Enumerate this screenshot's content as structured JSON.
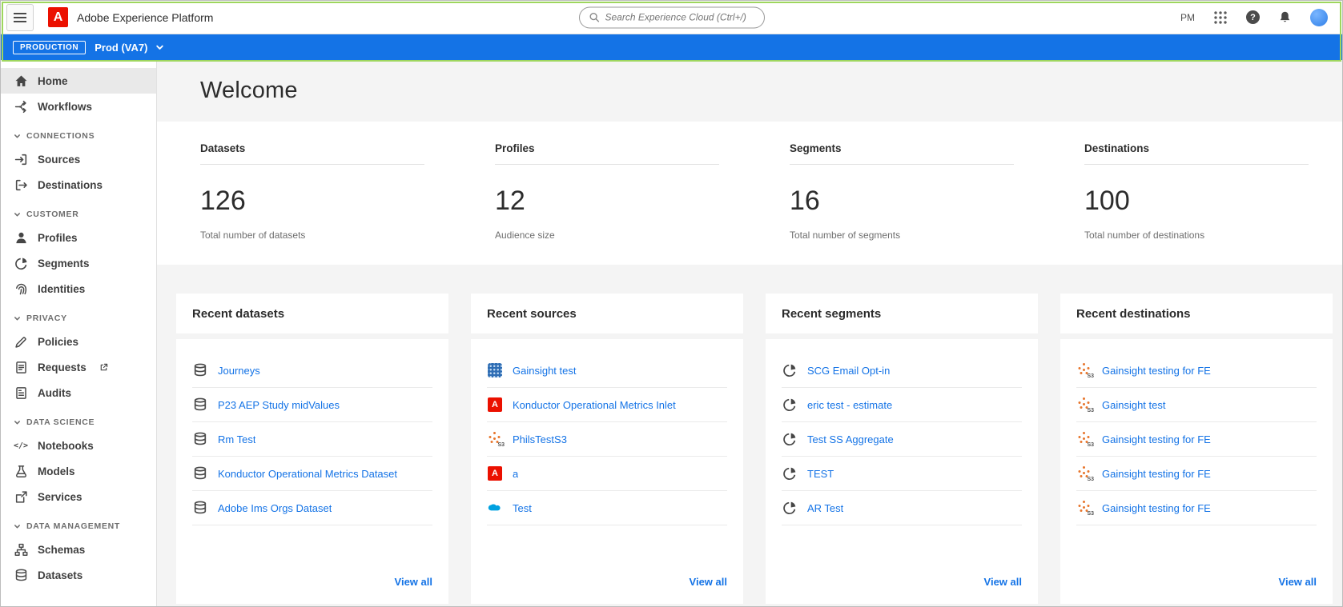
{
  "header": {
    "title": "Adobe Experience Platform",
    "search_placeholder": "Search Experience Cloud (Ctrl+/)",
    "time_label": "PM"
  },
  "sandbox_bar": {
    "env_label": "PRODUCTION",
    "sandbox_name": "Prod (VA7)"
  },
  "sidebar": {
    "top_items": [
      {
        "label": "Home",
        "icon": "home-icon",
        "active": true
      },
      {
        "label": "Workflows",
        "icon": "workflows-icon",
        "active": false
      }
    ],
    "sections": [
      {
        "title": "CONNECTIONS",
        "items": [
          {
            "label": "Sources",
            "icon": "sources-icon"
          },
          {
            "label": "Destinations",
            "icon": "destinations-icon"
          }
        ]
      },
      {
        "title": "CUSTOMER",
        "items": [
          {
            "label": "Profiles",
            "icon": "profiles-icon"
          },
          {
            "label": "Segments",
            "icon": "segments-icon"
          },
          {
            "label": "Identities",
            "icon": "identities-icon"
          }
        ]
      },
      {
        "title": "PRIVACY",
        "items": [
          {
            "label": "Policies",
            "icon": "policies-icon"
          },
          {
            "label": "Requests",
            "icon": "requests-icon",
            "external": true
          },
          {
            "label": "Audits",
            "icon": "audits-icon"
          }
        ]
      },
      {
        "title": "DATA SCIENCE",
        "items": [
          {
            "label": "Notebooks",
            "icon": "notebooks-icon"
          },
          {
            "label": "Models",
            "icon": "models-icon"
          },
          {
            "label": "Services",
            "icon": "services-icon"
          }
        ]
      },
      {
        "title": "DATA MANAGEMENT",
        "items": [
          {
            "label": "Schemas",
            "icon": "schemas-icon"
          },
          {
            "label": "Datasets",
            "icon": "datasets-icon"
          }
        ]
      }
    ]
  },
  "main": {
    "page_title": "Welcome",
    "stats": [
      {
        "label": "Datasets",
        "value": "126",
        "caption": "Total number of datasets"
      },
      {
        "label": "Profiles",
        "value": "12",
        "caption": "Audience size"
      },
      {
        "label": "Segments",
        "value": "16",
        "caption": "Total number of segments"
      },
      {
        "label": "Destinations",
        "value": "100",
        "caption": "Total number of destinations"
      }
    ],
    "cards": [
      {
        "title": "Recent datasets",
        "view_all": "View all",
        "items": [
          {
            "label": "Journeys",
            "icon": "dataset-icon"
          },
          {
            "label": "P23 AEP Study midValues",
            "icon": "dataset-icon"
          },
          {
            "label": "Rm Test",
            "icon": "dataset-icon"
          },
          {
            "label": "Konductor Operational Metrics Dataset",
            "icon": "dataset-icon"
          },
          {
            "label": "Adobe Ims Orgs Dataset",
            "icon": "dataset-icon"
          }
        ]
      },
      {
        "title": "Recent sources",
        "view_all": "View all",
        "items": [
          {
            "label": "Gainsight test",
            "icon": "gainsight-icon"
          },
          {
            "label": "Konductor Operational Metrics Inlet",
            "icon": "adobe-icon"
          },
          {
            "label": "PhilsTestS3",
            "icon": "s3-icon"
          },
          {
            "label": "a",
            "icon": "adobe-icon"
          },
          {
            "label": "Test",
            "icon": "salesforce-cloud-icon"
          }
        ]
      },
      {
        "title": "Recent segments",
        "view_all": "View all",
        "items": [
          {
            "label": "SCG Email Opt-in",
            "icon": "segment-icon"
          },
          {
            "label": "eric test - estimate",
            "icon": "segment-icon"
          },
          {
            "label": "Test SS Aggregate",
            "icon": "segment-icon"
          },
          {
            "label": "TEST",
            "icon": "segment-icon"
          },
          {
            "label": "AR Test",
            "icon": "segment-icon"
          }
        ]
      },
      {
        "title": "Recent destinations",
        "view_all": "View all",
        "items": [
          {
            "label": "Gainsight testing for FE",
            "icon": "s3-icon"
          },
          {
            "label": "Gainsight test",
            "icon": "s3-icon"
          },
          {
            "label": "Gainsight testing for FE",
            "icon": "s3-icon"
          },
          {
            "label": "Gainsight testing for FE",
            "icon": "s3-icon"
          },
          {
            "label": "Gainsight testing for FE",
            "icon": "s3-icon"
          }
        ]
      }
    ]
  },
  "colors": {
    "accent_blue": "#1473e6",
    "adobe_red": "#eb1000",
    "s3_orange": "#e8762d",
    "annotation_green": "#9ed65e"
  }
}
